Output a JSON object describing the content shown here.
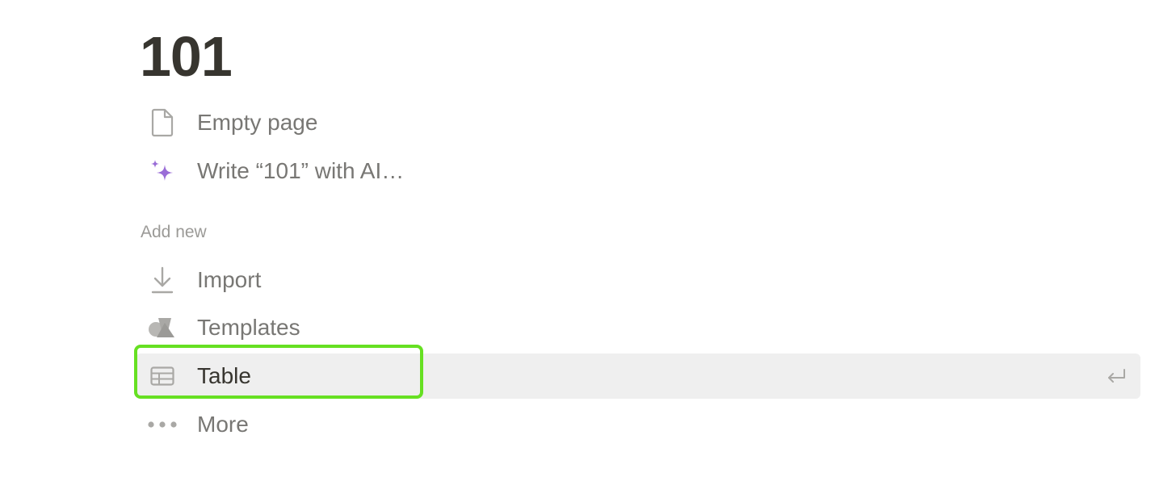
{
  "page": {
    "title": "101"
  },
  "options": {
    "empty_page": {
      "label": "Empty page",
      "icon": "document-icon"
    },
    "write_ai": {
      "label": "Write “101” with AI…",
      "icon": "sparkles-icon"
    }
  },
  "add_new": {
    "section_label": "Add new",
    "items": [
      {
        "label": "Import",
        "icon": "download-icon"
      },
      {
        "label": "Templates",
        "icon": "shapes-icon"
      },
      {
        "label": "Table",
        "icon": "table-icon",
        "selected": true,
        "shortcut_icon": "return-icon"
      },
      {
        "label": "More",
        "icon": "ellipsis-icon"
      }
    ]
  },
  "colors": {
    "title": "#37352f",
    "text_muted": "#787774",
    "section_label": "#9b9a97",
    "selected_bg": "#efefef",
    "highlight_outline": "#66e022",
    "ai_sparkle": "#9a6dd7"
  }
}
